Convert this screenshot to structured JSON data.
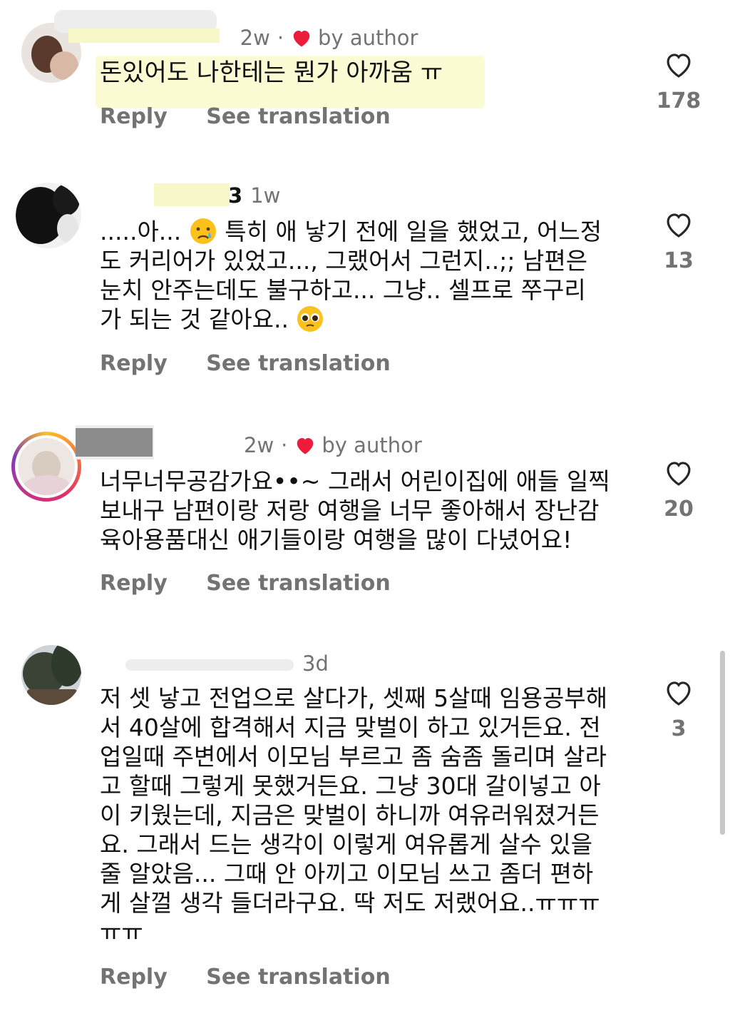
{
  "comments": [
    {
      "username": "...",
      "time": "2w",
      "separator": "·",
      "by_author": "by author",
      "text": "돈있어도 나한테는 뭔가 아까움 ㅠ",
      "reply": "Reply",
      "see_translation": "See translation",
      "likes": "178"
    },
    {
      "username": "...3",
      "time": "1w",
      "text_lines": [
        ".....아...",
        "특히 애 낳기 전에 일을 했었고, 어느정",
        "도 커리어가 있었고..., 그랬어서 그런지..;; 남편은",
        "눈치 안주는데도 불구하고... 그냥.. 셀프로  쭈구리",
        "가 되는 것 같아요.."
      ],
      "reply": "Reply",
      "see_translation": "See translation",
      "likes": "13"
    },
    {
      "username": "...",
      "time": "2w",
      "separator": "·",
      "by_author": "by author",
      "text_lines": [
        "너무너무공감가요••~ 그래서 어린이집에 애들 일찍",
        "보내구 남편이랑 저랑 여행을 너무 좋아해서 장난감",
        "육아용품대신 애기들이랑 여행을 많이 다녔어요!"
      ],
      "reply": "Reply",
      "see_translation": "See translation",
      "likes": "20"
    },
    {
      "username": "...",
      "time": "3d",
      "text_lines": [
        "저 셋 낳고 전업으로 살다가, 셋째 5살때 임용공부해",
        "서 40살에 합격해서 지금 맞벌이 하고 있거든요. 전",
        "업일때 주변에서 이모님 부르고 좀 숨좀 돌리며 살라",
        "고 할때 그렇게 못했거든요. 그냥 30대 갈이넣고 아",
        "이 키웠는데, 지금은 맞벌이 하니까 여유러워졌거든",
        "요. 그래서 드는 생각이 이렇게 여유롭게 살수 있을",
        "줄 알았음... 그때 안 아끼고 이모님 쓰고 좀더 편하",
        "게 살껄 생각 들더라구요. 딱 저도 저랬어요..ㅠㅠㅠ",
        "ㅠㅠ"
      ],
      "reply": "Reply",
      "see_translation": "See translation",
      "likes": "3"
    }
  ],
  "colors": {
    "secondary_text": "#737373",
    "heart_red": "#ed1c3b",
    "highlight": "#fbfbd4"
  },
  "icons": {
    "like": "heart-outline-icon",
    "author_like": "heart-filled-icon"
  }
}
